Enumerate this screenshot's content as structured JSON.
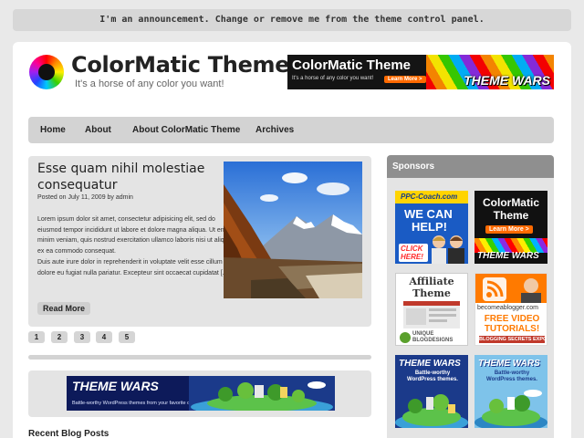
{
  "announcement": "I'm an announcement. Change or remove me from the theme control panel.",
  "header": {
    "title": "ColorMatic Theme",
    "tagline": "It's a horse of any color you want!",
    "ad": {
      "title": "ColorMatic Theme",
      "subtitle": "It's a horse of any color you want!",
      "button": "Learn More >",
      "brand": "THEME WARS"
    }
  },
  "nav": {
    "items": [
      "Home",
      "About",
      "About ColorMatic Theme",
      "Archives"
    ]
  },
  "post": {
    "title": "Esse quam nihil molestiae consequatur",
    "meta": "Posted on July 11, 2009 by admin",
    "excerpt": "Lorem ipsum dolor sit amet, consectetur adipisicing elit, sed do eiusmod tempor incididunt ut labore et dolore magna aliqua. Ut enim ad minim veniam, quis nostrud exercitation ullamco laboris nisi ut aliquip ex ea commodo consequat.\nDuis aute irure dolor in reprehenderit in voluptate velit esse cillum dolore eu fugiat nulla pariatur. Excepteur sint occaecat cupidatat [...]",
    "read_more": "Read More"
  },
  "pagination": [
    "1",
    "2",
    "3",
    "4",
    "5"
  ],
  "banner": {
    "title": "THEME WARS",
    "subtitle": "Battle-worthy WordPress themes from your favorite designers."
  },
  "recent_posts": {
    "title": "Recent Blog Posts"
  },
  "sponsors": {
    "title": "Sponsors",
    "ads": {
      "ppc": {
        "brand": "PPC-Coach.com",
        "line1": "WE CAN",
        "line2": "HELP!",
        "cta": "CLICK HERE!"
      },
      "colormatic": {
        "line1": "ColorMatic",
        "line2": "Theme",
        "button": "Learn More >",
        "brand": "THEME WARS"
      },
      "affiliate": {
        "line1": "Affiliate",
        "line2": "Theme",
        "brand": "UNIQUE BLOGDESIGNS"
      },
      "blogger": {
        "brand": "becomeablogger.com",
        "line1": "FREE VIDEO",
        "line2": "TUTORIALS!",
        "line3": "BLOGGING SECRETS EXPOSED!"
      },
      "themewars1": {
        "title": "THEME WARS",
        "sub": "Battle-worthy WordPress themes."
      },
      "themewars2": {
        "title": "THEME WARS",
        "sub": "Battle-worthy WordPress themes."
      }
    }
  },
  "colors": {
    "nav_bg": "#d3d3d3",
    "box_bg": "#e4e4e4",
    "sponsor_head": "#8f8f8f",
    "ppc_blue": "#1a5bc4",
    "blogger_orange": "#ff7a00"
  }
}
